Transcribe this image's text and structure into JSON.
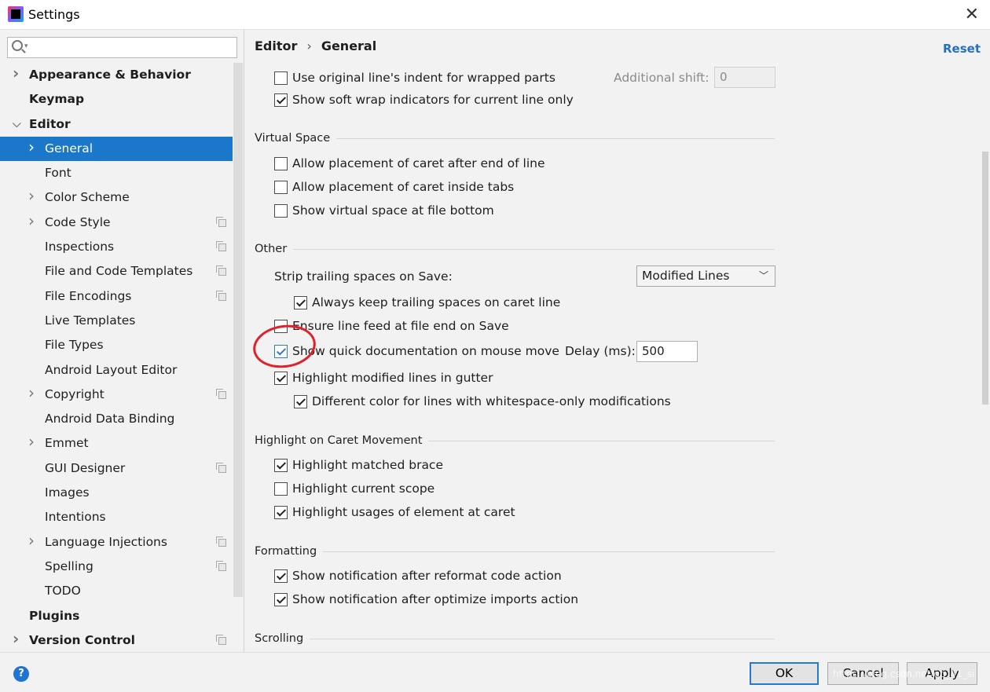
{
  "window": {
    "title": "Settings"
  },
  "search": {
    "placeholder": ""
  },
  "sidebar": {
    "items": [
      {
        "label": "Appearance & Behavior",
        "bold": true,
        "chevron": "right",
        "level": 0,
        "copy": false
      },
      {
        "label": "Keymap",
        "bold": true,
        "chevron": "",
        "level": 0,
        "copy": false
      },
      {
        "label": "Editor",
        "bold": true,
        "chevron": "down",
        "level": 0,
        "copy": false
      },
      {
        "label": "General",
        "bold": false,
        "chevron": "right",
        "level": 1,
        "copy": false,
        "selected": true
      },
      {
        "label": "Font",
        "bold": false,
        "chevron": "",
        "level": 1,
        "copy": false
      },
      {
        "label": "Color Scheme",
        "bold": false,
        "chevron": "right",
        "level": 1,
        "copy": false
      },
      {
        "label": "Code Style",
        "bold": false,
        "chevron": "right",
        "level": 1,
        "copy": true
      },
      {
        "label": "Inspections",
        "bold": false,
        "chevron": "",
        "level": 1,
        "copy": true
      },
      {
        "label": "File and Code Templates",
        "bold": false,
        "chevron": "",
        "level": 1,
        "copy": true
      },
      {
        "label": "File Encodings",
        "bold": false,
        "chevron": "",
        "level": 1,
        "copy": true
      },
      {
        "label": "Live Templates",
        "bold": false,
        "chevron": "",
        "level": 1,
        "copy": false
      },
      {
        "label": "File Types",
        "bold": false,
        "chevron": "",
        "level": 1,
        "copy": false
      },
      {
        "label": "Android Layout Editor",
        "bold": false,
        "chevron": "",
        "level": 1,
        "copy": false
      },
      {
        "label": "Copyright",
        "bold": false,
        "chevron": "right",
        "level": 1,
        "copy": true
      },
      {
        "label": "Android Data Binding",
        "bold": false,
        "chevron": "",
        "level": 1,
        "copy": false
      },
      {
        "label": "Emmet",
        "bold": false,
        "chevron": "right",
        "level": 1,
        "copy": false
      },
      {
        "label": "GUI Designer",
        "bold": false,
        "chevron": "",
        "level": 1,
        "copy": true
      },
      {
        "label": "Images",
        "bold": false,
        "chevron": "",
        "level": 1,
        "copy": false
      },
      {
        "label": "Intentions",
        "bold": false,
        "chevron": "",
        "level": 1,
        "copy": false
      },
      {
        "label": "Language Injections",
        "bold": false,
        "chevron": "right",
        "level": 1,
        "copy": true
      },
      {
        "label": "Spelling",
        "bold": false,
        "chevron": "",
        "level": 1,
        "copy": true
      },
      {
        "label": "TODO",
        "bold": false,
        "chevron": "",
        "level": 1,
        "copy": false
      },
      {
        "label": "Plugins",
        "bold": true,
        "chevron": "",
        "level": 0,
        "copy": false
      },
      {
        "label": "Version Control",
        "bold": true,
        "chevron": "right",
        "level": 0,
        "copy": true
      }
    ]
  },
  "header": {
    "breadcrumb_parent": "Editor",
    "breadcrumb_sep": "›",
    "breadcrumb_current": "General",
    "reset_label": "Reset"
  },
  "options": {
    "use_original_indent": {
      "label": "Use original line's indent for wrapped parts",
      "checked": false
    },
    "additional_shift_label": "Additional shift:",
    "additional_shift_value": "0",
    "show_soft_wrap": {
      "label": "Show soft wrap indicators for current line only",
      "checked": true
    },
    "virtual_space_title": "Virtual Space",
    "caret_after_end": {
      "label": "Allow placement of caret after end of line",
      "checked": false
    },
    "caret_inside_tabs": {
      "label": "Allow placement of caret inside tabs",
      "checked": false
    },
    "virtual_space_bottom": {
      "label": "Show virtual space at file bottom",
      "checked": false
    },
    "other_title": "Other",
    "strip_trailing_label": "Strip trailing spaces on Save:",
    "strip_trailing_value": "Modified Lines",
    "keep_trailing_caret": {
      "label": "Always keep trailing spaces on caret line",
      "checked": true
    },
    "ensure_line_feed": {
      "label": "Ensure line feed at file end on Save",
      "checked": false
    },
    "quick_doc": {
      "label": "Show quick documentation on mouse move",
      "checked": true
    },
    "delay_label": "Delay (ms):",
    "delay_value": "500",
    "highlight_modified": {
      "label": "Highlight modified lines in gutter",
      "checked": true
    },
    "different_color_ws": {
      "label": "Different color for lines with whitespace-only modifications",
      "checked": true
    },
    "caret_movement_title": "Highlight on Caret Movement",
    "highlight_brace": {
      "label": "Highlight matched brace",
      "checked": true
    },
    "highlight_scope": {
      "label": "Highlight current scope",
      "checked": false
    },
    "highlight_usages": {
      "label": "Highlight usages of element at caret",
      "checked": true
    },
    "formatting_title": "Formatting",
    "notify_reformat": {
      "label": "Show notification after reformat code action",
      "checked": true
    },
    "notify_optimize": {
      "label": "Show notification after optimize imports action",
      "checked": true
    },
    "scrolling_title": "Scrolling"
  },
  "footer": {
    "help_glyph": "?",
    "ok_label": "OK",
    "cancel_label": "Cancel",
    "apply_label": "Apply",
    "watermark": "https://blog.csdn.net/qq_41_si"
  },
  "colors": {
    "selection": "#1a77c9",
    "link": "#2470c2",
    "annotation": "#e0202a"
  }
}
